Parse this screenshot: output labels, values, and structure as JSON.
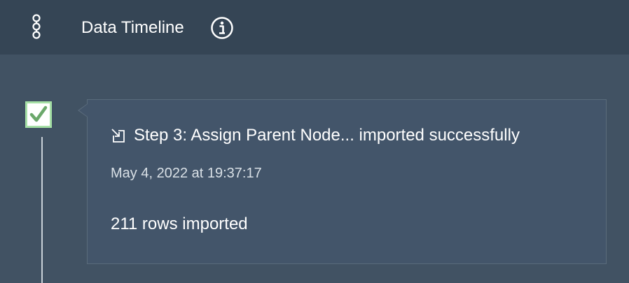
{
  "header": {
    "title": "Data Timeline",
    "icon": "timeline-icon",
    "info_icon": "info-icon"
  },
  "timeline": {
    "entries": [
      {
        "status_icon": "check-icon",
        "status_color": "#a6e0a6",
        "type_icon": "import-icon",
        "title": "Step 3: Assign Parent Node... imported successfully",
        "timestamp": "May 4, 2022 at 19:37:17",
        "detail": "211 rows imported"
      }
    ]
  },
  "colors": {
    "header_bg": "#354555",
    "content_bg": "#415263",
    "card_bg": "#43556a",
    "card_border": "#5a6b7b",
    "text_primary": "#ffffff",
    "text_secondary": "#d9e0e6"
  }
}
